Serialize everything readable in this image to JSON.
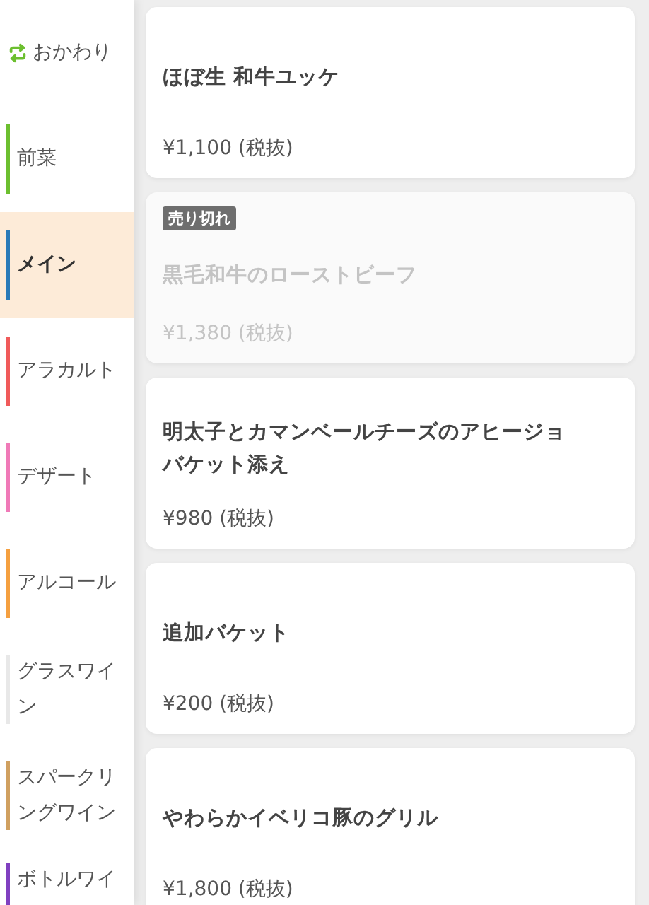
{
  "sidebar": {
    "items": [
      {
        "kind": "refill",
        "label": "おかわり",
        "selected": false
      },
      {
        "kind": "category",
        "label": "前菜",
        "color": "#6cbf2f",
        "selected": false
      },
      {
        "kind": "category",
        "label": "メイン",
        "color": "#2a7ab8",
        "selected": true
      },
      {
        "kind": "category",
        "label": "アラカルト",
        "color": "#f05a5a",
        "selected": false
      },
      {
        "kind": "category",
        "label": "デザート",
        "color": "#f07ab8",
        "selected": false
      },
      {
        "kind": "category",
        "label": "アルコール",
        "color": "#f5a040",
        "selected": false
      },
      {
        "kind": "category",
        "label": "グラスワイン",
        "color": "#e8e8e8",
        "selected": false
      },
      {
        "kind": "category",
        "label": "スパークリングワイン",
        "color": "#d0a060",
        "selected": false
      },
      {
        "kind": "category",
        "label": "ボトルワイ",
        "color": "#8040c0",
        "selected": false
      }
    ]
  },
  "menu_items": [
    {
      "name": "ほぼ生 和牛ユッケ",
      "price": "¥1,100 (税抜)",
      "sold_out": false
    },
    {
      "name": "黒毛和牛のローストビーフ",
      "price": "¥1,380 (税抜)",
      "sold_out": true,
      "badge": "売り切れ"
    },
    {
      "name": "明太子とカマンベールチーズのアヒージョバケット添え",
      "price": "¥980 (税抜)",
      "sold_out": false
    },
    {
      "name": "追加バケット",
      "price": "¥200 (税抜)",
      "sold_out": false
    },
    {
      "name": "やわらかイベリコ豚のグリル",
      "price": "¥1,800 (税抜)",
      "sold_out": false
    }
  ]
}
